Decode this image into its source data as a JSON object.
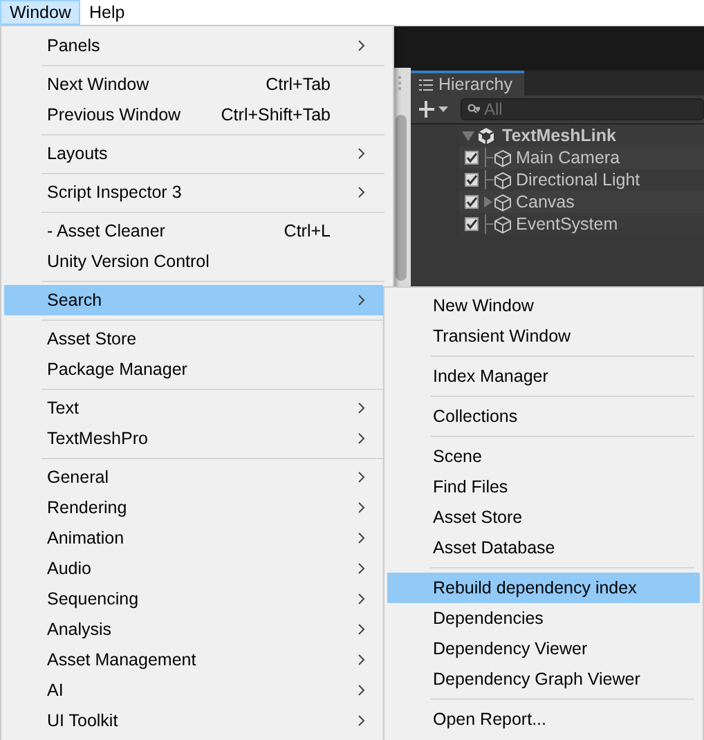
{
  "menu_bar": [
    {
      "label": "Window",
      "selected": true
    },
    {
      "label": "Help",
      "selected": false
    }
  ],
  "hierarchy": {
    "tab": "Hierarchy",
    "search_placeholder": "All",
    "scene": {
      "name": "TextMeshLink",
      "expanded": true,
      "children": [
        {
          "name": "Main Camera",
          "checked": true,
          "expandable": false
        },
        {
          "name": "Directional Light",
          "checked": true,
          "expandable": false
        },
        {
          "name": "Canvas",
          "checked": true,
          "expandable": true
        },
        {
          "name": "EventSystem",
          "checked": true,
          "expandable": false
        }
      ]
    }
  },
  "window_menu": {
    "items": [
      {
        "kind": "item",
        "label": "Panels",
        "has_submenu": true,
        "selected": false
      },
      {
        "kind": "separator"
      },
      {
        "kind": "item",
        "label": "Next Window",
        "shortcut": "Ctrl+Tab",
        "has_submenu": false,
        "selected": false
      },
      {
        "kind": "item",
        "label": "Previous Window",
        "shortcut": "Ctrl+Shift+Tab",
        "has_submenu": false,
        "selected": false
      },
      {
        "kind": "separator"
      },
      {
        "kind": "item",
        "label": "Layouts",
        "has_submenu": true,
        "selected": false
      },
      {
        "kind": "separator"
      },
      {
        "kind": "item",
        "label": "Script Inspector 3",
        "has_submenu": true,
        "selected": false
      },
      {
        "kind": "separator"
      },
      {
        "kind": "item",
        "label": "- Asset Cleaner",
        "shortcut": "Ctrl+L",
        "has_submenu": false,
        "selected": false
      },
      {
        "kind": "item",
        "label": "Unity Version Control",
        "has_submenu": false,
        "selected": false
      },
      {
        "kind": "separator"
      },
      {
        "kind": "item",
        "label": "Search",
        "has_submenu": true,
        "selected": true
      },
      {
        "kind": "separator"
      },
      {
        "kind": "item",
        "label": "Asset Store",
        "has_submenu": false,
        "selected": false
      },
      {
        "kind": "item",
        "label": "Package Manager",
        "has_submenu": false,
        "selected": false
      },
      {
        "kind": "separator"
      },
      {
        "kind": "item",
        "label": "Text",
        "has_submenu": true,
        "selected": false
      },
      {
        "kind": "item",
        "label": "TextMeshPro",
        "has_submenu": true,
        "selected": false
      },
      {
        "kind": "separator"
      },
      {
        "kind": "item",
        "label": "General",
        "has_submenu": true,
        "selected": false
      },
      {
        "kind": "item",
        "label": "Rendering",
        "has_submenu": true,
        "selected": false
      },
      {
        "kind": "item",
        "label": "Animation",
        "has_submenu": true,
        "selected": false
      },
      {
        "kind": "item",
        "label": "Audio",
        "has_submenu": true,
        "selected": false
      },
      {
        "kind": "item",
        "label": "Sequencing",
        "has_submenu": true,
        "selected": false
      },
      {
        "kind": "item",
        "label": "Analysis",
        "has_submenu": true,
        "selected": false
      },
      {
        "kind": "item",
        "label": "Asset Management",
        "has_submenu": true,
        "selected": false
      },
      {
        "kind": "item",
        "label": "AI",
        "has_submenu": true,
        "selected": false
      },
      {
        "kind": "item",
        "label": "UI Toolkit",
        "has_submenu": true,
        "selected": false
      }
    ]
  },
  "search_submenu": {
    "items": [
      {
        "kind": "item",
        "label": "New Window",
        "selected": false
      },
      {
        "kind": "item",
        "label": "Transient Window",
        "selected": false
      },
      {
        "kind": "separator"
      },
      {
        "kind": "item",
        "label": "Index Manager",
        "selected": false
      },
      {
        "kind": "separator"
      },
      {
        "kind": "item",
        "label": "Collections",
        "selected": false
      },
      {
        "kind": "separator"
      },
      {
        "kind": "item",
        "label": "Scene",
        "selected": false
      },
      {
        "kind": "item",
        "label": "Find Files",
        "selected": false
      },
      {
        "kind": "item",
        "label": "Asset Store",
        "selected": false
      },
      {
        "kind": "item",
        "label": "Asset Database",
        "selected": false
      },
      {
        "kind": "separator"
      },
      {
        "kind": "item",
        "label": "Rebuild dependency index",
        "selected": true
      },
      {
        "kind": "item",
        "label": "Dependencies",
        "selected": false
      },
      {
        "kind": "item",
        "label": "Dependency Viewer",
        "selected": false
      },
      {
        "kind": "item",
        "label": "Dependency Graph Viewer",
        "selected": false
      },
      {
        "kind": "separator"
      },
      {
        "kind": "item",
        "label": "Open Report...",
        "selected": false
      }
    ]
  }
}
